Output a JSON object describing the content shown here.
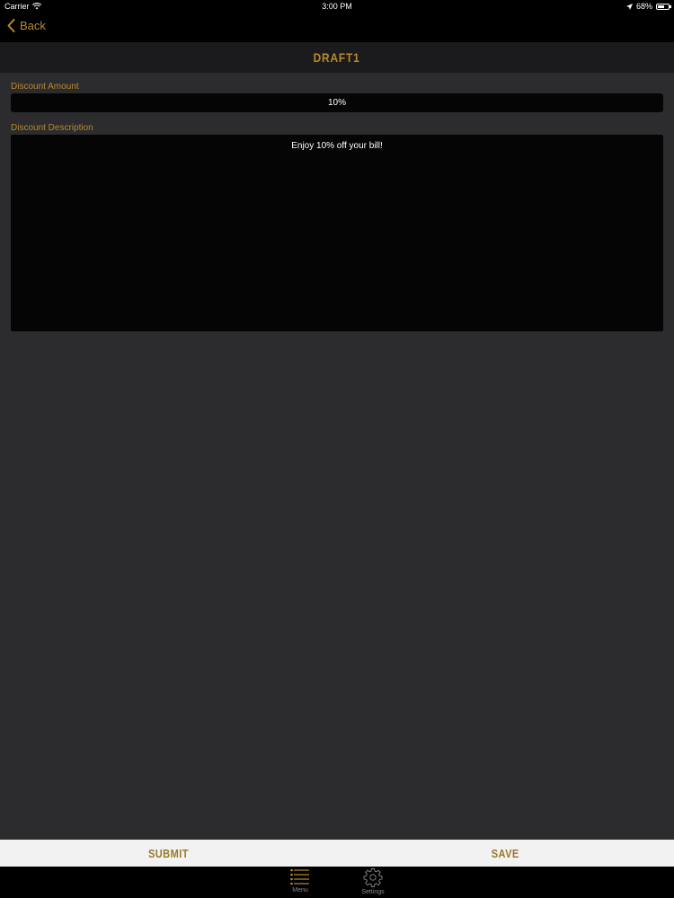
{
  "status_bar": {
    "carrier": "Carrier",
    "time": "3:00 PM",
    "battery": "68%",
    "battery_level": 0.68
  },
  "nav": {
    "back_label": "Back"
  },
  "header": {
    "title": "DRAFT1"
  },
  "form": {
    "amount_label": "Discount Amount",
    "amount_value": "10%",
    "description_label": "Discount Description",
    "description_value": "Enjoy 10% off your bill!"
  },
  "actions": {
    "submit_label": "SUBMIT",
    "save_label": "SAVE"
  },
  "tab_bar": {
    "items": [
      {
        "label": "Menu",
        "icon": "menu-list-icon"
      },
      {
        "label": "Settings",
        "icon": "gear-icon"
      }
    ]
  },
  "colors": {
    "accent": "#b88a2e",
    "background": "#2c2b2d",
    "field": "#050505"
  }
}
